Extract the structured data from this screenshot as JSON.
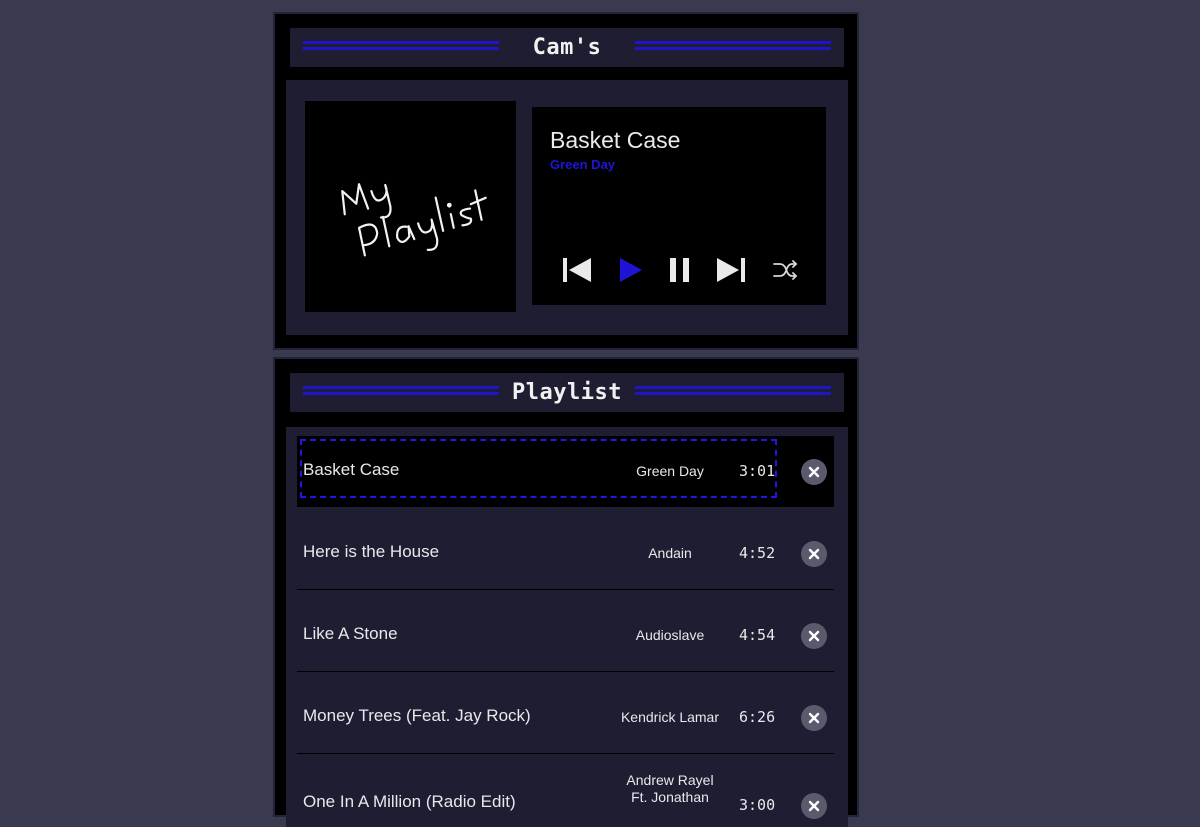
{
  "player": {
    "header_title": "Cam's",
    "album_art_text_line1": "My",
    "album_art_text_line2": "Playlist",
    "now_playing": {
      "title": "Basket Case",
      "artist": "Green Day"
    },
    "controls": {
      "previous_icon": "skip-previous-icon",
      "play_icon": "play-icon",
      "pause_icon": "pause-icon",
      "next_icon": "skip-next-icon",
      "shuffle_icon": "shuffle-icon"
    }
  },
  "playlist": {
    "header_title": "Playlist",
    "tracks": [
      {
        "title": "Basket Case",
        "artist": "Green Day",
        "duration": "3:01",
        "active": true
      },
      {
        "title": "Here is the House",
        "artist": "Andain",
        "duration": "4:52"
      },
      {
        "title": "Like A Stone",
        "artist": "Audioslave",
        "duration": "4:54"
      },
      {
        "title": "Money Trees (Feat. Jay Rock)",
        "artist": "Kendrick Lamar",
        "duration": "6:26"
      },
      {
        "title": "One In A Million (Radio Edit)",
        "artist_line1": "Andrew Rayel",
        "artist_line2": "Ft. Jonathan",
        "duration": "3:00"
      }
    ]
  },
  "colors": {
    "accent": "#1f14d6",
    "background": "#393a50",
    "panel": "#1e1d31"
  }
}
